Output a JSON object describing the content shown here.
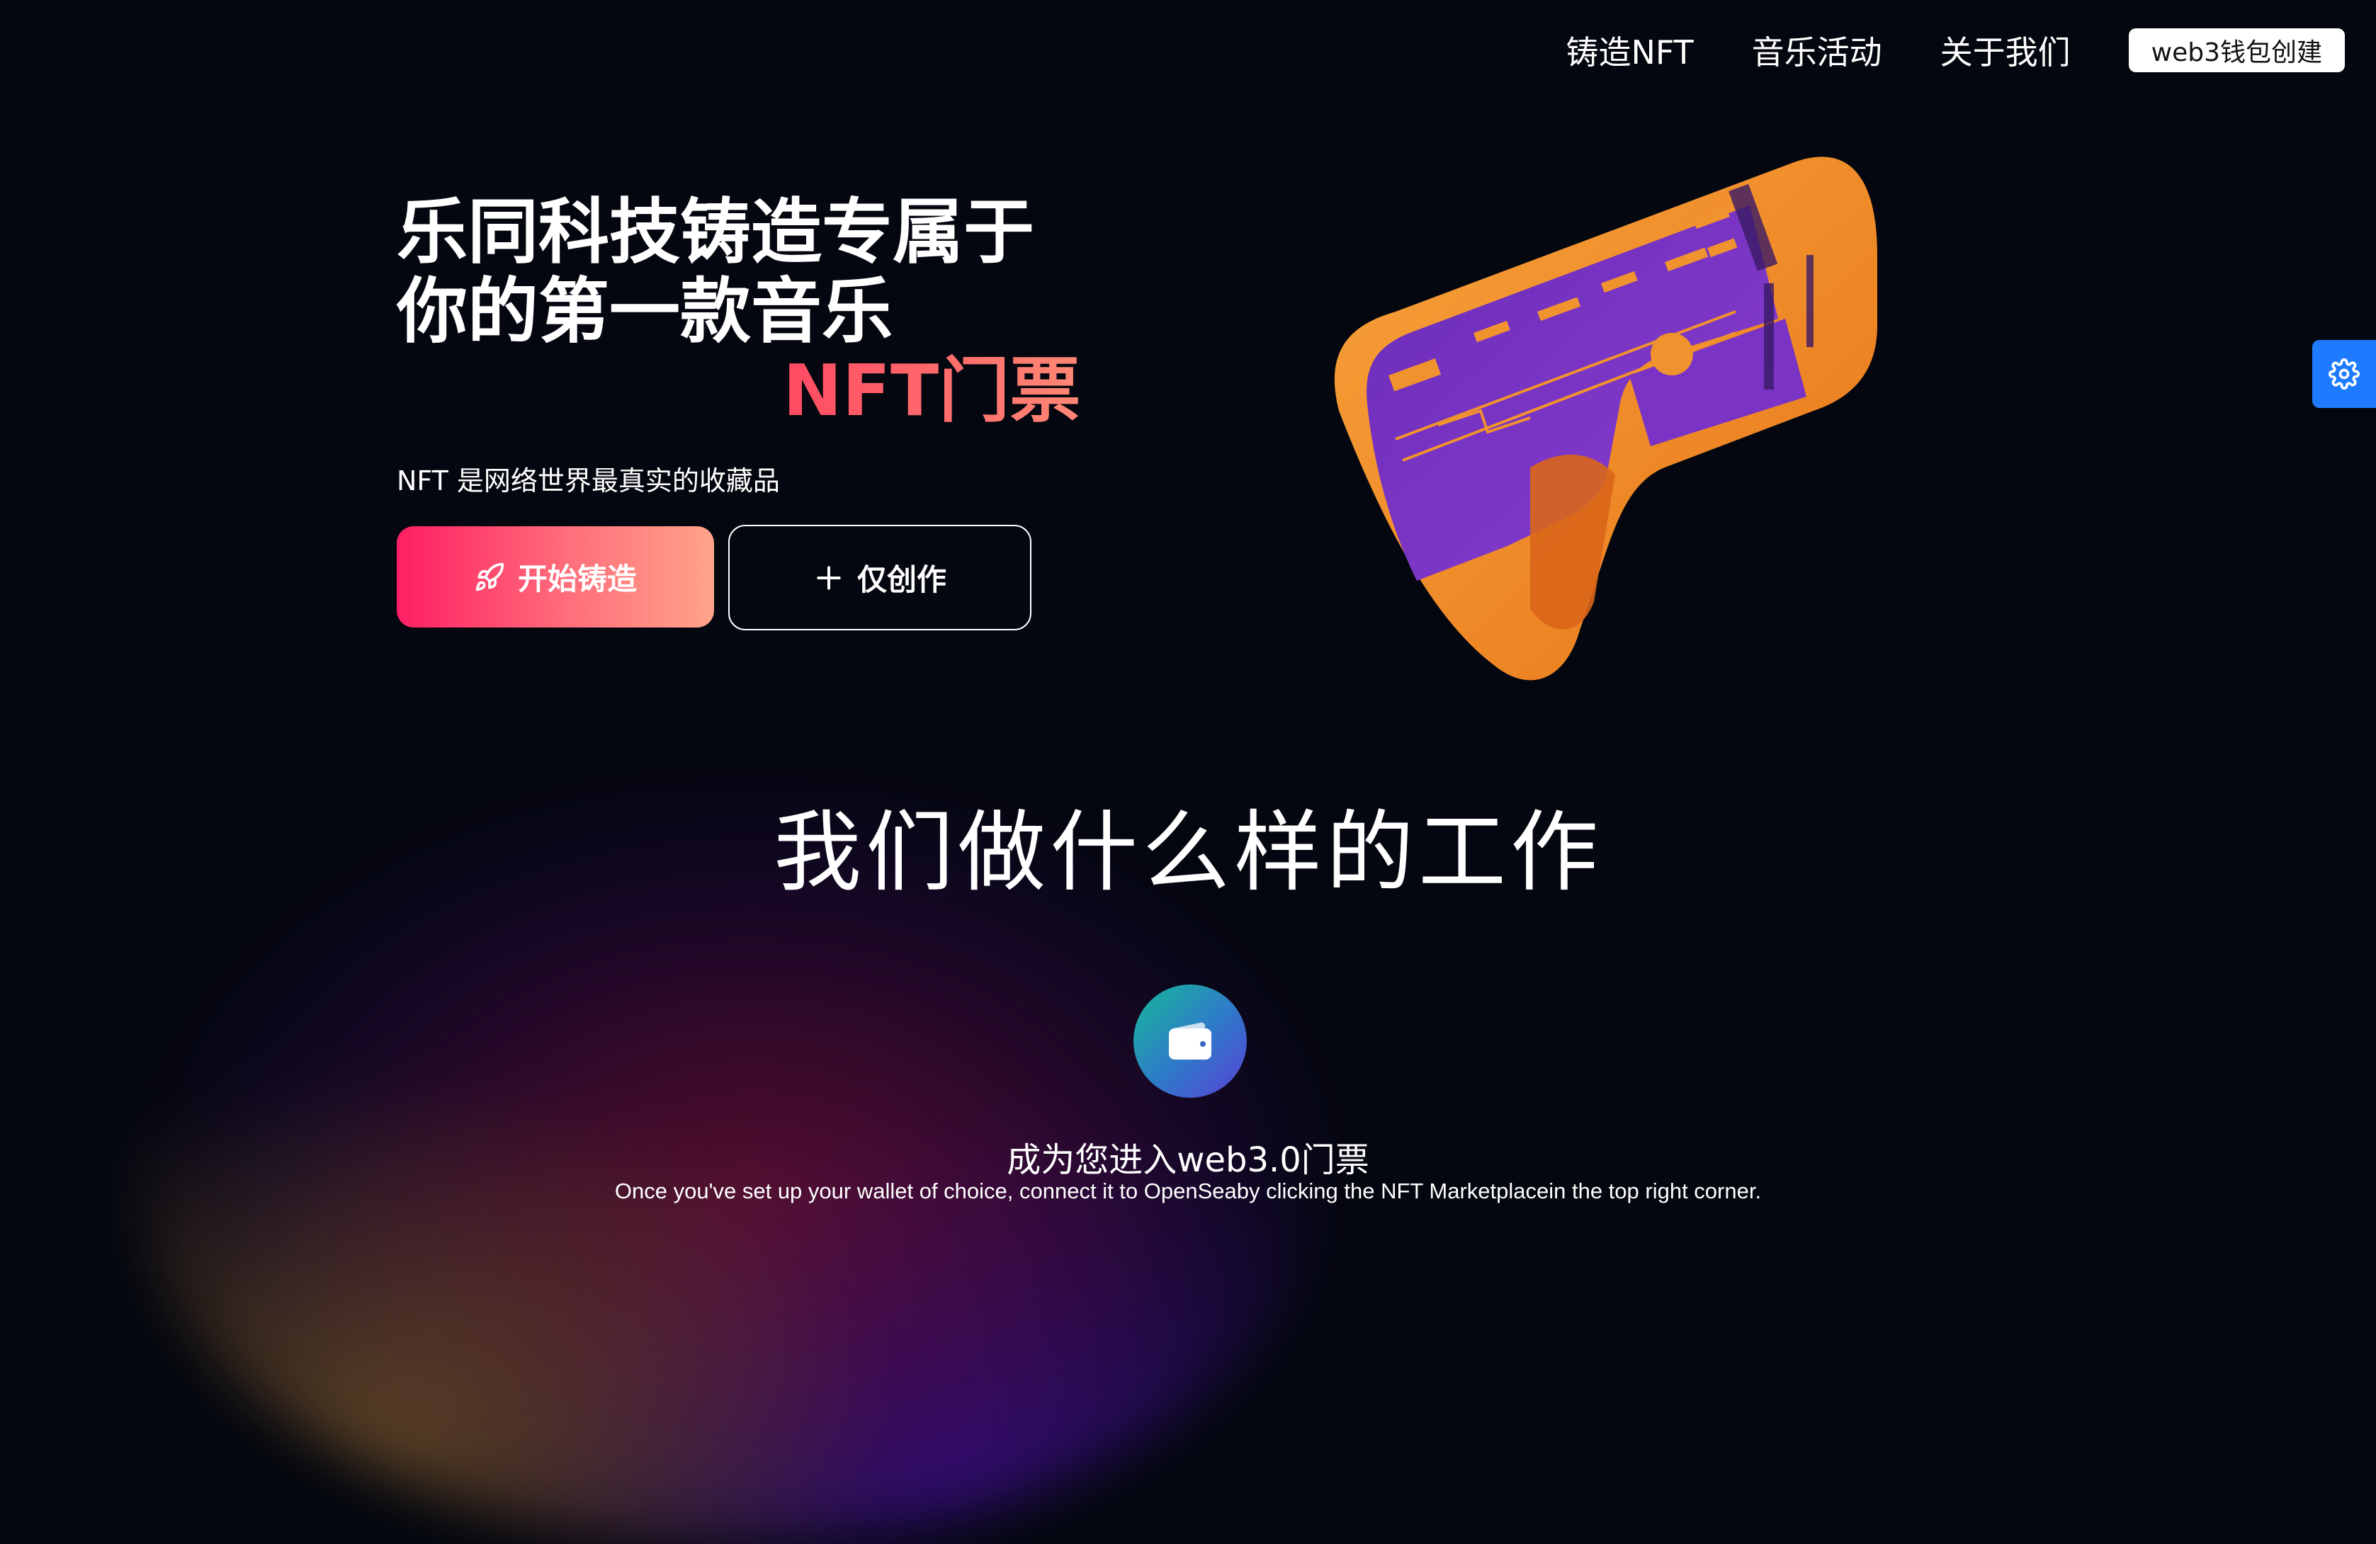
{
  "nav": {
    "links": [
      "铸造NFT",
      "音乐活动",
      "关于我们"
    ],
    "wallet_button": "web3钱包创建"
  },
  "hero": {
    "title_line1": "乐同科技铸造专属于",
    "title_line2": "你的第一款音乐",
    "title_line3": "NFT门票",
    "subtitle": "NFT 是网络世界最真实的收藏品",
    "primary_button": "开始铸造",
    "secondary_button": "仅创作"
  },
  "section": {
    "title": "我们做什么样的工作"
  },
  "feature": {
    "icon": "wallet-icon",
    "title": "成为您进入web3.0门票",
    "description": "Once you've set up your wallet of choice, connect it to OpenSeaby clicking the NFT Marketplacein the top right corner."
  },
  "colors": {
    "background": "#04070f",
    "accent_gradient_start": "#ff1f63",
    "accent_gradient_end": "#ffa48a",
    "settings_tab": "#1e7bff"
  }
}
